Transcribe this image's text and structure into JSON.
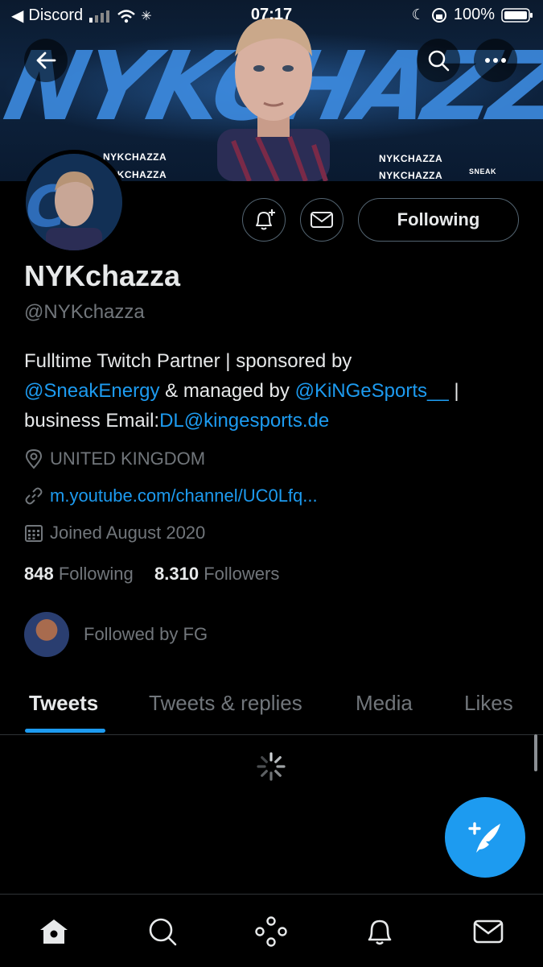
{
  "status_bar": {
    "carrier": "Discord",
    "time": "07:17",
    "battery": "100%"
  },
  "banner": {
    "headline": "NYKCHAZZA",
    "tags": [
      "NYKCHAZZA",
      "NYKCHAZZA",
      "NYKCHAZZA",
      "NYKCHAZZA"
    ],
    "sponsor": "SNEAK"
  },
  "profile": {
    "name": "NYKchazza",
    "handle": "@NYKchazza",
    "following_button": "Following",
    "bio": {
      "line1": "Fulltime Twitch Partner | sponsored by",
      "mention1": "@SneakEnergy",
      "middle": " & managed by ",
      "mention2": "@KiNGeSports__",
      "sep": " |",
      "line3_prefix": "business Email:",
      "email": "DL@kingesports.de"
    },
    "location": "UNITED KINGDOM",
    "website": "m.youtube.com/channel/UC0Lfq...",
    "joined": "Joined August 2020",
    "following_count": "848",
    "following_label": "Following",
    "followers_count": "8.310",
    "followers_label": "Followers",
    "followed_by": "Followed by FG"
  },
  "tabs": [
    "Tweets",
    "Tweets & replies",
    "Media",
    "Likes"
  ],
  "colors": {
    "accent": "#1d9bf0",
    "background": "#000000",
    "muted": "#71767b"
  }
}
